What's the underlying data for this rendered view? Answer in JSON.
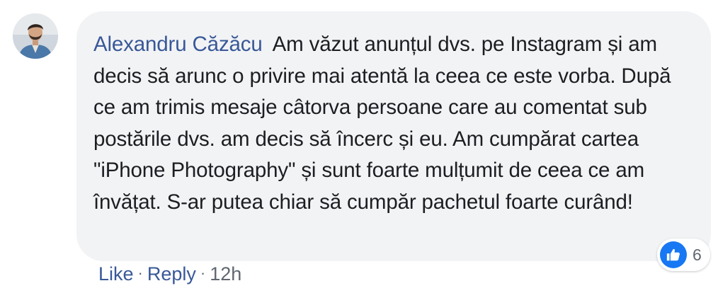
{
  "comment": {
    "author": "Alexandru Căzăcu",
    "text": "Am văzut anunțul dvs. pe Instagram și am decis să arunc o privire mai atentă la ceea ce este vorba. După ce am trimis mesaje câtorva persoane care au comentat sub postările dvs. am decis să încerc și eu. Am cumpărat cartea \"iPhone Photography\" și sunt foarte mulțumit de ceea ce am învățat. S-ar putea chiar să cumpăr pachetul foarte curând!",
    "reaction_icon": "like-thumbs-up-icon",
    "reaction_count": "6"
  },
  "actions": {
    "like_label": "Like",
    "reply_label": "Reply",
    "timestamp": "12h",
    "separator": "·"
  },
  "colors": {
    "author_link": "#385898",
    "bubble_bg": "#f2f3f5",
    "like_blue": "#1877f2",
    "meta_gray": "#606770"
  }
}
